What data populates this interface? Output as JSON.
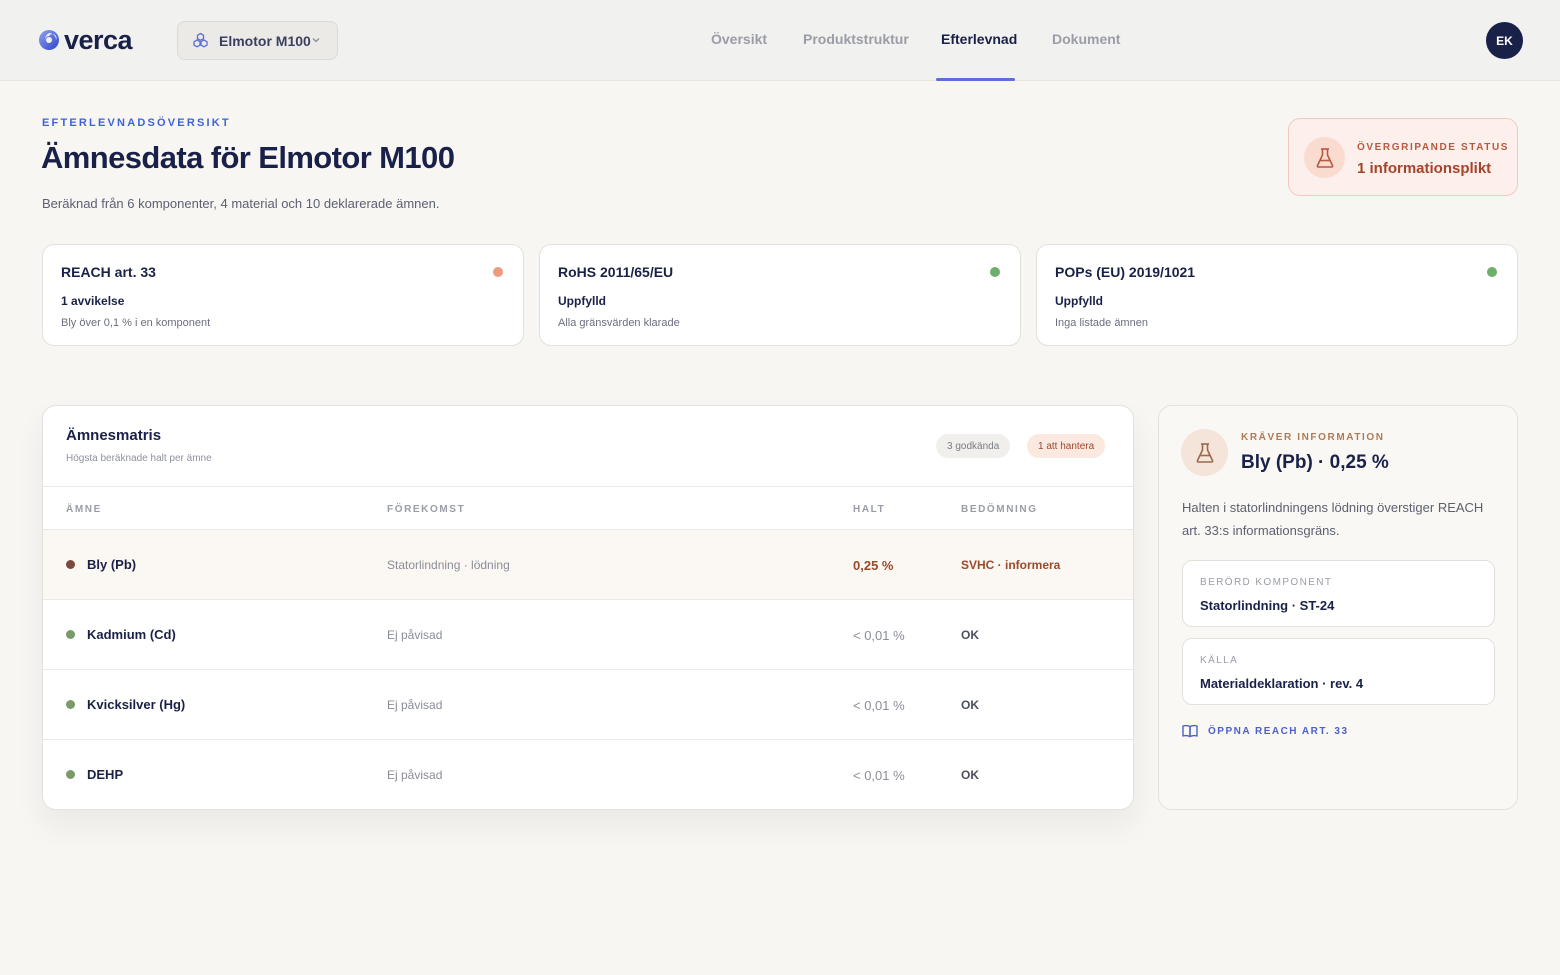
{
  "brand": {
    "name": "verca"
  },
  "product_selector": {
    "value": "Elmotor M100"
  },
  "nav": {
    "tabs": [
      {
        "label": "Översikt"
      },
      {
        "label": "Produktstruktur"
      },
      {
        "label": "Efterlevnad"
      },
      {
        "label": "Dokument"
      }
    ],
    "active": "Efterlevnad"
  },
  "user": {
    "initials": "EK"
  },
  "header": {
    "eyebrow": "EFTERLEVNADSÖVERSIKT",
    "title": "Ämnesdata för Elmotor M100",
    "subtitle": "Beräknad från 6 komponenter, 4 material och 10 deklarerade ämnen."
  },
  "overall_status": {
    "label": "ÖVERGRIPANDE STATUS",
    "value": "1 informationsplikt"
  },
  "regulations": [
    {
      "name": "REACH art. 33",
      "state": "1 avvikelse",
      "detail": "Bly över 0,1 % i en komponent",
      "color": "#ef9a7c"
    },
    {
      "name": "RoHS 2011/65/EU",
      "state": "Uppfylld",
      "detail": "Alla gränsvärden klarade",
      "color": "#6fae6d"
    },
    {
      "name": "POPs (EU) 2019/1021",
      "state": "Uppfylld",
      "detail": "Inga listade ämnen",
      "color": "#6fae6d"
    }
  ],
  "matrix": {
    "title": "Ämnesmatris",
    "subtitle": "Högsta beräknade halt per ämne",
    "badge_ok": "3 godkända",
    "badge_warn": "1 att hantera",
    "columns": {
      "substance": "ÄMNE",
      "occurrence": "FÖREKOMST",
      "content": "HALT",
      "assessment": "BEDÖMNING"
    },
    "rows": [
      {
        "substance": "Bly (Pb)",
        "occurrence": "Statorlindning · lödning",
        "content": "0,25 %",
        "assessment": "SVHC · informera",
        "dot_color": "#7b4a3a"
      },
      {
        "substance": "Kadmium (Cd)",
        "occurrence": "Ej påvisad",
        "content": "< 0,01 %",
        "assessment": "OK",
        "dot_color": "#7a9a6a"
      },
      {
        "substance": "Kvicksilver (Hg)",
        "occurrence": "Ej påvisad",
        "content": "< 0,01 %",
        "assessment": "OK",
        "dot_color": "#7a9a6a"
      },
      {
        "substance": "DEHP",
        "occurrence": "Ej påvisad",
        "content": "< 0,01 %",
        "assessment": "OK",
        "dot_color": "#7a9a6a"
      }
    ]
  },
  "detail_panel": {
    "eyebrow": "KRÄVER INFORMATION",
    "title": "Bly (Pb) · 0,25 %",
    "description": "Halten i statorlindningens lödning överstiger REACH art. 33:s informationsgräns.",
    "component_label": "BERÖRD KOMPONENT",
    "component_value": "Statorlindning · ST-24",
    "source_label": "KÄLLA",
    "source_value": "Materialdeklaration · rev. 4",
    "link": "ÖPPNA REACH ART. 33"
  }
}
